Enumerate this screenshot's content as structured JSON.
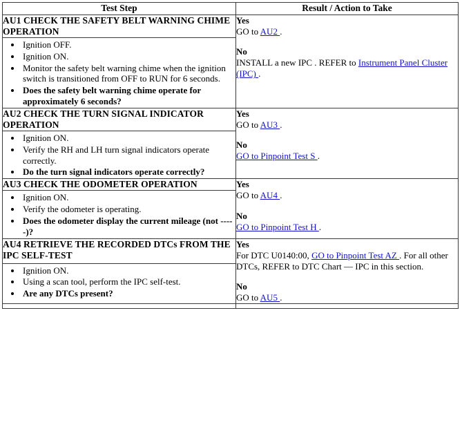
{
  "table": {
    "columns": [
      {
        "label": "Test Step"
      },
      {
        "label": "Result / Action to Take"
      }
    ],
    "link_color": "#1111cc",
    "border_color": "#3a3a3a",
    "steps": [
      {
        "id": "AU1",
        "title": "AU1 CHECK THE SAFETY BELT WARNING CHIME OPERATION",
        "bullets": [
          {
            "text": "Ignition OFF.",
            "bold": false
          },
          {
            "text": "Ignition ON.",
            "bold": false
          },
          {
            "text": "Monitor the safety belt warning chime when the ignition switch is transitioned from OFF to RUN for 6 seconds.",
            "bold": false
          },
          {
            "text": "Does the safety belt warning chime operate for approximately 6 seconds?",
            "bold": true
          }
        ],
        "results": [
          {
            "label": "Yes",
            "parts": [
              {
                "type": "text",
                "text": "GO to "
              },
              {
                "type": "link",
                "text": "AU2 "
              },
              {
                "type": "text",
                "text": "."
              }
            ]
          },
          {
            "label": "No",
            "parts": [
              {
                "type": "text",
                "text": "INSTALL a new IPC . REFER to "
              },
              {
                "type": "link",
                "text": "Instrument Panel Cluster (IPC) "
              },
              {
                "type": "text",
                "text": "."
              }
            ]
          }
        ]
      },
      {
        "id": "AU2",
        "title": "AU2 CHECK THE TURN SIGNAL INDICATOR OPERATION",
        "bullets": [
          {
            "text": "Ignition ON.",
            "bold": false
          },
          {
            "text": "Verify the RH and LH turn signal indicators operate correctly.",
            "bold": false
          },
          {
            "text": "Do the turn signal indicators operate correctly?",
            "bold": true
          }
        ],
        "results": [
          {
            "label": "Yes",
            "parts": [
              {
                "type": "text",
                "text": "GO to "
              },
              {
                "type": "link",
                "text": "AU3 "
              },
              {
                "type": "text",
                "text": "."
              }
            ]
          },
          {
            "label": "No",
            "parts": [
              {
                "type": "link",
                "text": "GO to Pinpoint Test S "
              },
              {
                "type": "text",
                "text": "."
              }
            ]
          }
        ]
      },
      {
        "id": "AU3",
        "title": "AU3 CHECK THE ODOMETER OPERATION",
        "bullets": [
          {
            "text": "Ignition ON.",
            "bold": false
          },
          {
            "text": "Verify the odometer is operating.",
            "bold": false
          },
          {
            "text": "Does the odometer display the current mileage (not -----)?",
            "bold": true
          }
        ],
        "results": [
          {
            "label": "Yes",
            "parts": [
              {
                "type": "text",
                "text": "GO to "
              },
              {
                "type": "link",
                "text": "AU4 "
              },
              {
                "type": "text",
                "text": "."
              }
            ]
          },
          {
            "label": "No",
            "parts": [
              {
                "type": "link",
                "text": "GO to Pinpoint Test H "
              },
              {
                "type": "text",
                "text": "."
              }
            ]
          }
        ]
      },
      {
        "id": "AU4",
        "title": "AU4 RETRIEVE THE RECORDED DTCs FROM THE IPC SELF-TEST",
        "bullets": [
          {
            "text": "Ignition ON.",
            "bold": false
          },
          {
            "text": "Using a scan tool, perform the IPC self-test.",
            "bold": false
          },
          {
            "text": "Are any DTCs present?",
            "bold": true
          }
        ],
        "results": [
          {
            "label": "Yes",
            "parts": [
              {
                "type": "text",
                "text": "For DTC U0140:00, "
              },
              {
                "type": "link",
                "text": "GO to Pinpoint Test AZ "
              },
              {
                "type": "text",
                "text": ". For all other DTCs, REFER to DTC Chart — IPC in this section."
              }
            ]
          },
          {
            "label": "No",
            "parts": [
              {
                "type": "text",
                "text": "GO to "
              },
              {
                "type": "link",
                "text": "AU5 "
              },
              {
                "type": "text",
                "text": "."
              }
            ]
          }
        ]
      }
    ]
  }
}
